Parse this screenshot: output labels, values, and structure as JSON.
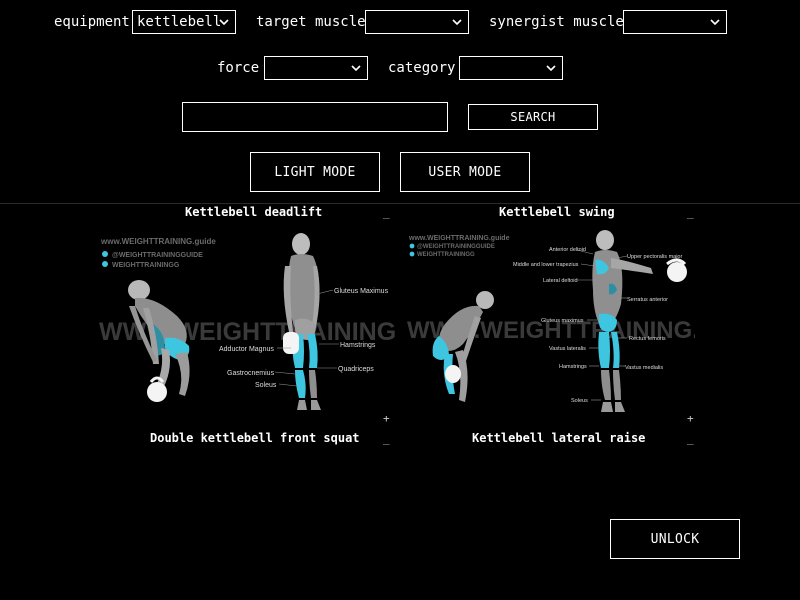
{
  "filters": {
    "equipment": {
      "label": "equipment",
      "value": "kettlebell"
    },
    "target_muscle": {
      "label": "target muscle",
      "value": ""
    },
    "synergist_muscle": {
      "label": "synergist muscle",
      "value": ""
    },
    "force": {
      "label": "force",
      "value": ""
    },
    "category": {
      "label": "category",
      "value": ""
    }
  },
  "search": {
    "value": "",
    "button": "SEARCH"
  },
  "modes": {
    "light": "LIGHT MODE",
    "user": "USER MODE"
  },
  "cards": [
    {
      "title": "Kettlebell deadlift",
      "collapse": "_",
      "expand": "+",
      "watermark": {
        "site": "www.WEIGHTTRAINING.guide",
        "insta": "@WEIGHTTRAININGGUIDE",
        "pin": "WEIGHTTRAININGG",
        "big": "WWW.WEIGHTTRAINING.GUIDE"
      },
      "muscles": [
        "Gluteus Maximus",
        "Adductor Magnus",
        "Hamstrings",
        "Gastrocnemius",
        "Quadriceps",
        "Soleus"
      ]
    },
    {
      "title": "Kettlebell swing",
      "collapse": "_",
      "expand": "+",
      "watermark": {
        "site": "www.WEIGHTTRAINING.guide",
        "insta": "@WEIGHTTRAININGGUIDE",
        "pin": "WEIGHTTRAININGG",
        "big": "WWW.WEIGHTTRAINING.GUIDE"
      },
      "muscles": [
        "Anterior deltoid",
        "Upper pectoralis major",
        "Middle and lower trapezius",
        "Lateral deltoid",
        "Serratus anterior",
        "Gluteus maximus",
        "Rectus femoris",
        "Vastus lateralis",
        "Hamstrings",
        "Vastus medialis",
        "Soleus"
      ]
    },
    {
      "title": "Double kettlebell front squat",
      "collapse": "_"
    },
    {
      "title": "Kettlebell lateral raise",
      "collapse": "_"
    }
  ],
  "unlock": "UNLOCK",
  "colors": {
    "background": "#000000",
    "foreground": "#ffffff",
    "muscle_highlight": "#3ec6e0"
  }
}
